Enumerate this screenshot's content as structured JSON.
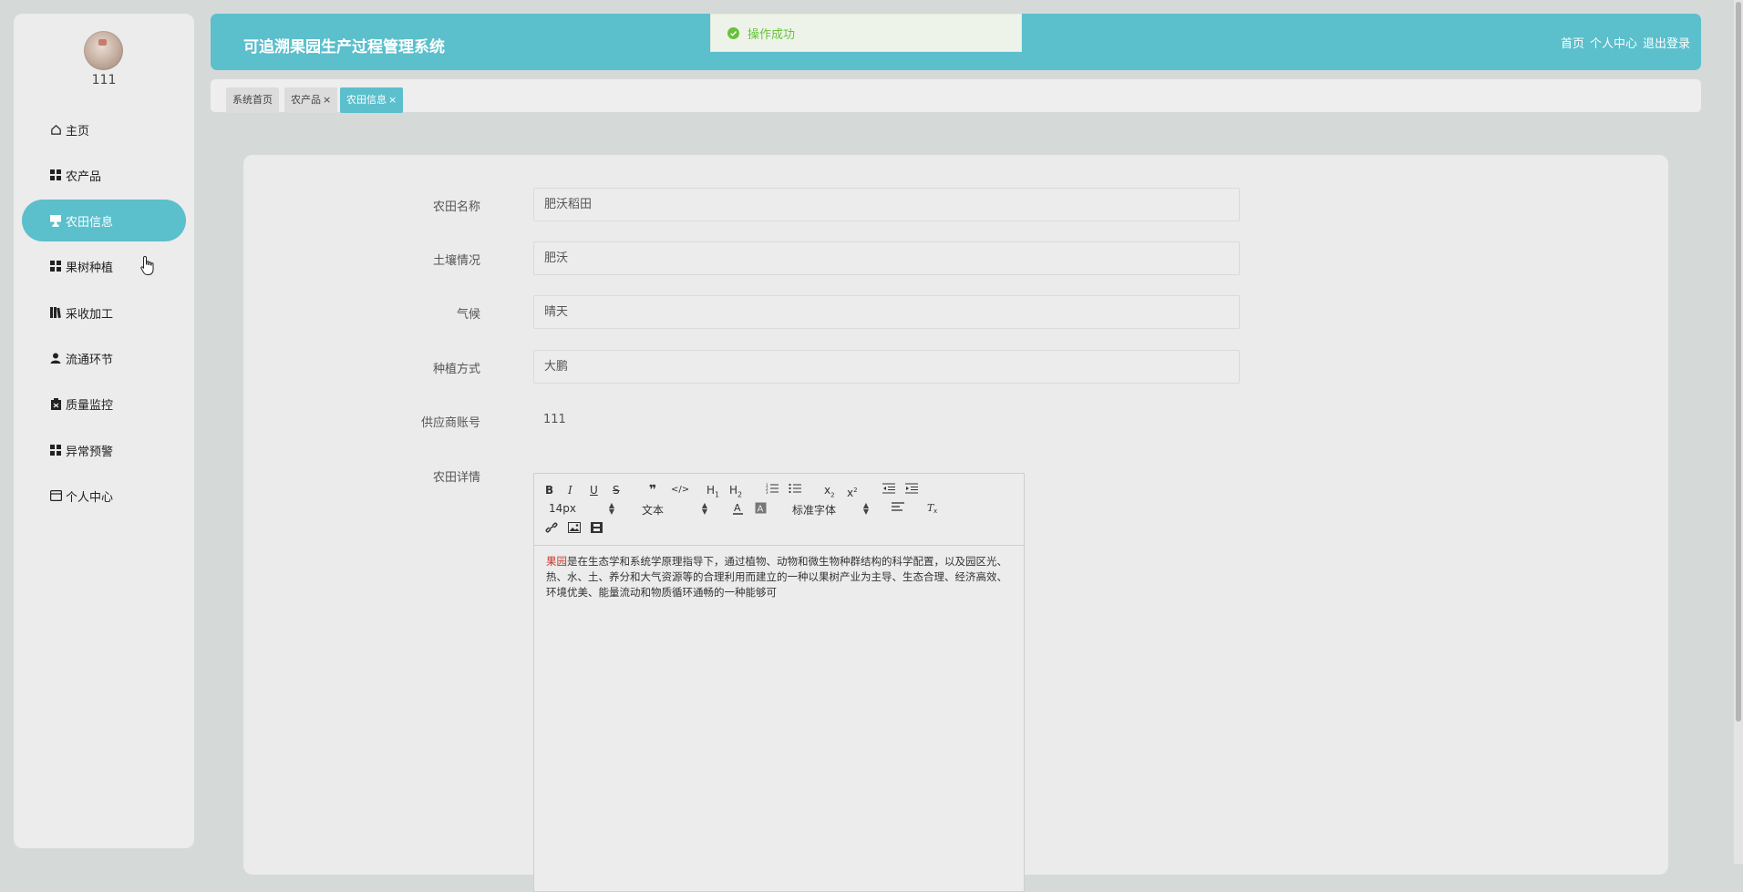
{
  "app": {
    "title": "可追溯果园生产过程管理系统"
  },
  "user": {
    "name": "111"
  },
  "header": {
    "links": [
      "首页",
      "个人中心",
      "退出登录"
    ]
  },
  "toast": {
    "message": "操作成功",
    "type": "success",
    "color": "#67c23a"
  },
  "theme": {
    "accent": "#5bbfcc",
    "background": "#d5dad9"
  },
  "sidebar": {
    "items": [
      {
        "label": "主页",
        "icon": "home-icon",
        "active": false
      },
      {
        "label": "农产品",
        "icon": "grid-icon",
        "active": false
      },
      {
        "label": "农田信息",
        "icon": "field-icon",
        "active": true
      },
      {
        "label": "果树种植",
        "icon": "grid-icon",
        "active": false
      },
      {
        "label": "采收加工",
        "icon": "book-icon",
        "active": false
      },
      {
        "label": "流通环节",
        "icon": "user-icon",
        "active": false
      },
      {
        "label": "质量监控",
        "icon": "clipboard-icon",
        "active": false
      },
      {
        "label": "异常预警",
        "icon": "grid-icon",
        "active": false
      },
      {
        "label": "个人中心",
        "icon": "card-icon",
        "active": false
      }
    ]
  },
  "tabs": [
    {
      "label": "系统首页",
      "closable": false,
      "active": false
    },
    {
      "label": "农产品",
      "closable": true,
      "active": false
    },
    {
      "label": "农田信息",
      "closable": true,
      "active": true
    }
  ],
  "form": {
    "fields": [
      {
        "label": "农田名称",
        "value": "肥沃稻田"
      },
      {
        "label": "土壤情况",
        "value": "肥沃"
      },
      {
        "label": "气候",
        "value": "晴天"
      },
      {
        "label": "种植方式",
        "value": "大鹏"
      }
    ],
    "supplier": {
      "label": "供应商账号",
      "value": "111"
    },
    "detail": {
      "label": "农田详情",
      "toolbar": {
        "size": "14px",
        "header": "文本",
        "font": "标准字体"
      },
      "content_highlight": "果园",
      "content_rest": "是在生态学和系统学原理指导下，通过植物、动物和微生物种群结构的科学配置，以及园区光、热、水、土、养分和大气资源等的合理利用而建立的一种以果树产业为主导、生态合理、经济高效、环境优美、能量流动和物质循环通畅的一种能够可"
    }
  }
}
